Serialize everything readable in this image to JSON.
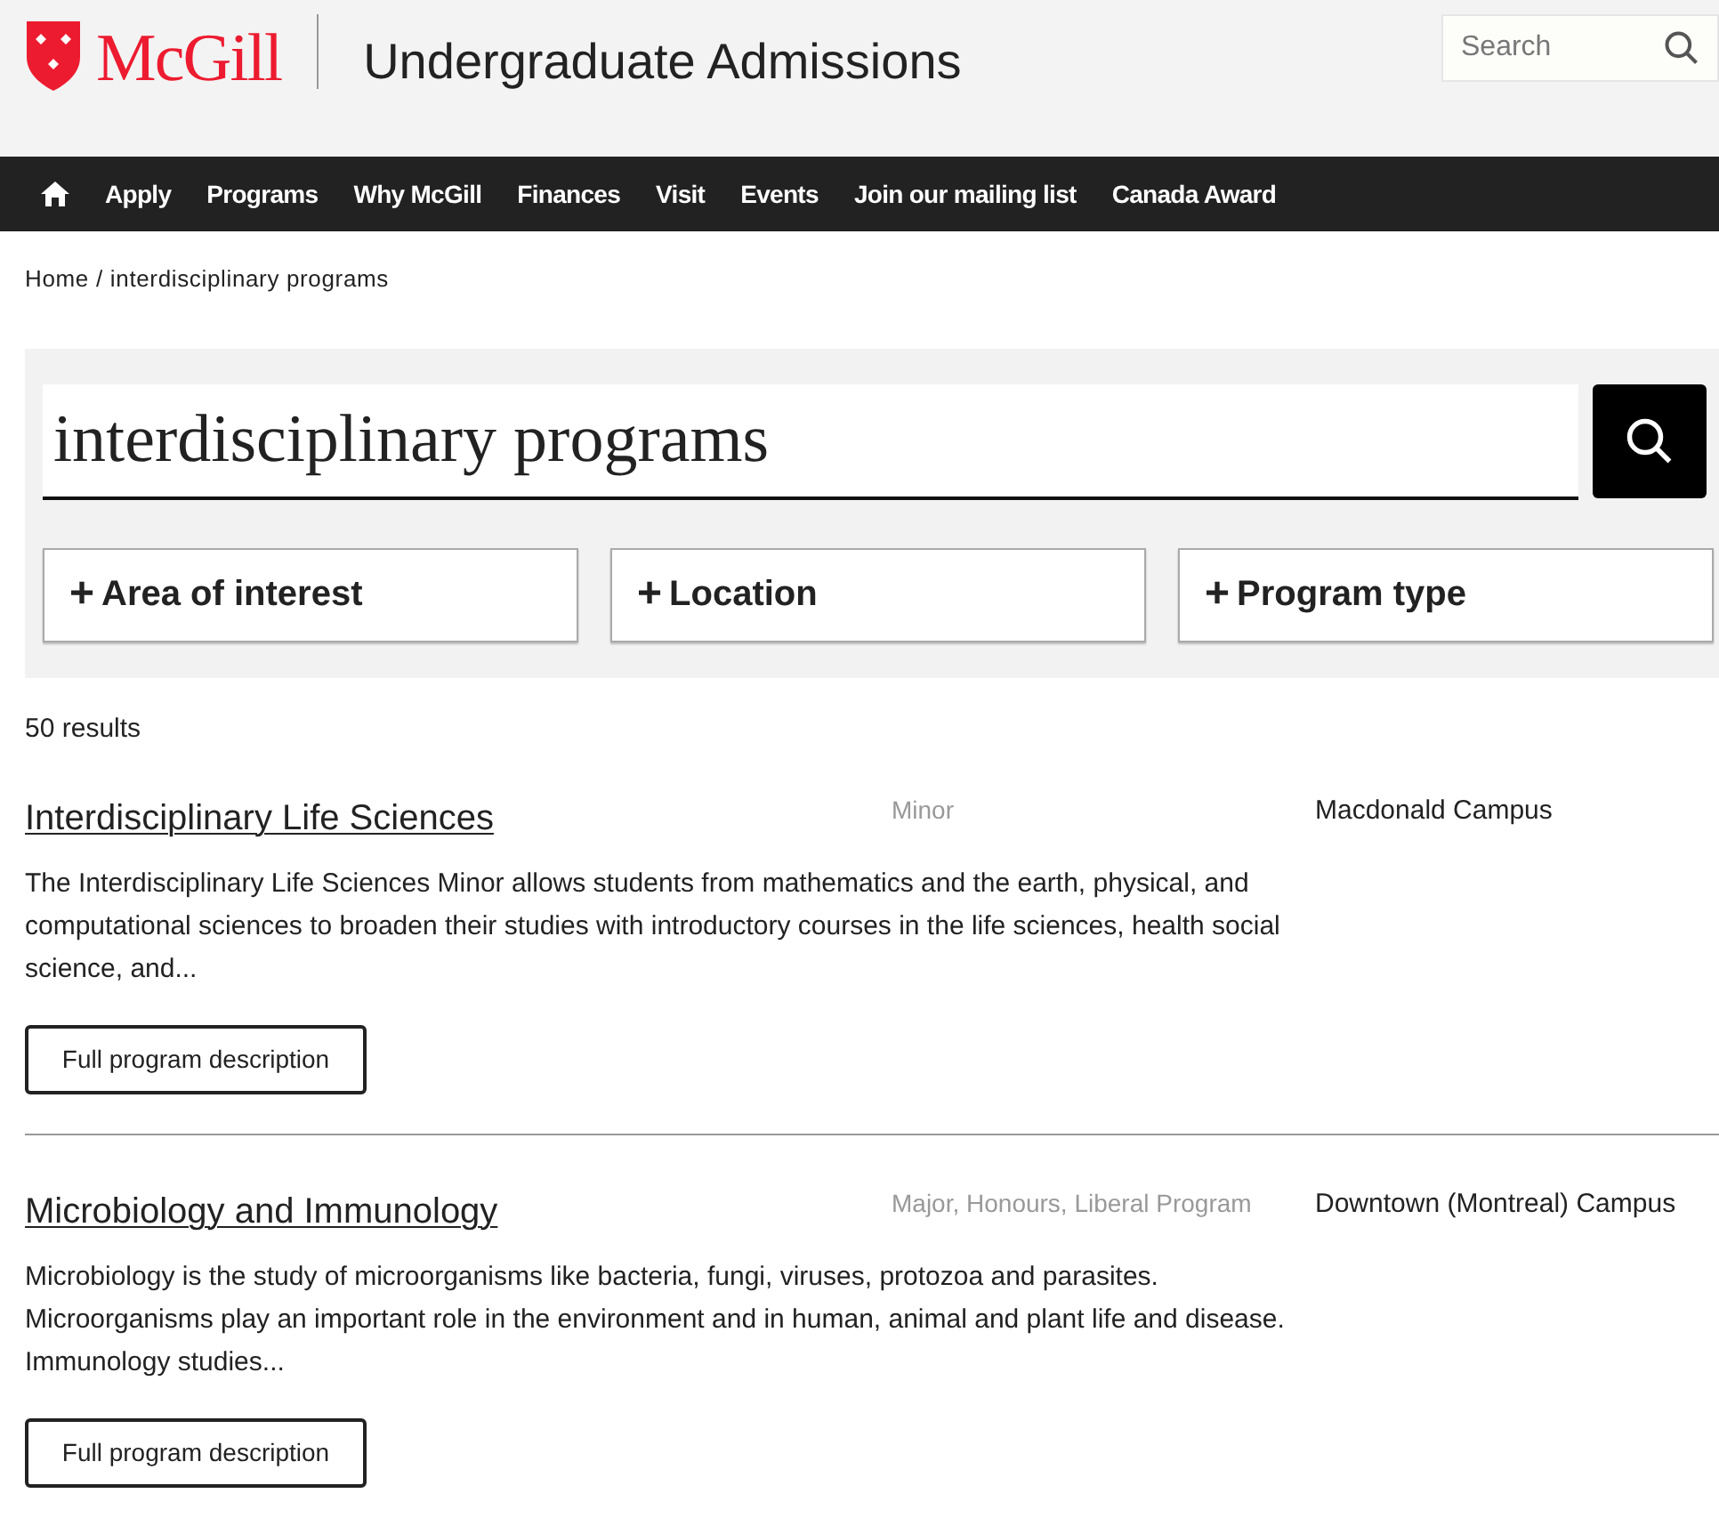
{
  "header": {
    "logo_text": "McGill",
    "site_title": "Undergraduate Admissions",
    "search": {
      "placeholder": "Search"
    }
  },
  "nav": {
    "items": [
      "Apply",
      "Programs",
      "Why McGill",
      "Finances",
      "Visit",
      "Events",
      "Join our mailing list",
      "Canada Award"
    ]
  },
  "breadcrumb": [
    "Home",
    "interdisciplinary programs"
  ],
  "breadcrumb_separator": "/",
  "search_panel": {
    "query": "interdisciplinary programs",
    "filters": [
      {
        "icon": "+",
        "label": "Area of interest"
      },
      {
        "icon": "+",
        "label": "Location"
      },
      {
        "icon": "+",
        "label": "Program type"
      }
    ]
  },
  "results_count": "50 results",
  "results": [
    {
      "title": "Interdisciplinary Life Sciences",
      "type": "Minor",
      "campus": "Macdonald Campus",
      "description": "The Interdisciplinary Life Sciences Minor allows students from mathematics and the earth, physical, and computational sciences to broaden their studies with introductory courses in the life sciences, health social science, and...",
      "button": "Full program description"
    },
    {
      "title": "Microbiology and Immunology",
      "type": "Major, Honours, Liberal Program",
      "campus": "Downtown (Montreal) Campus",
      "description": "Microbiology is the study of microorganisms like bacteria, fungi, viruses, protozoa and parasites. Microorganisms play an important role in the environment and in human, animal and plant life and disease. Immunology studies...",
      "button": "Full program description"
    }
  ]
}
